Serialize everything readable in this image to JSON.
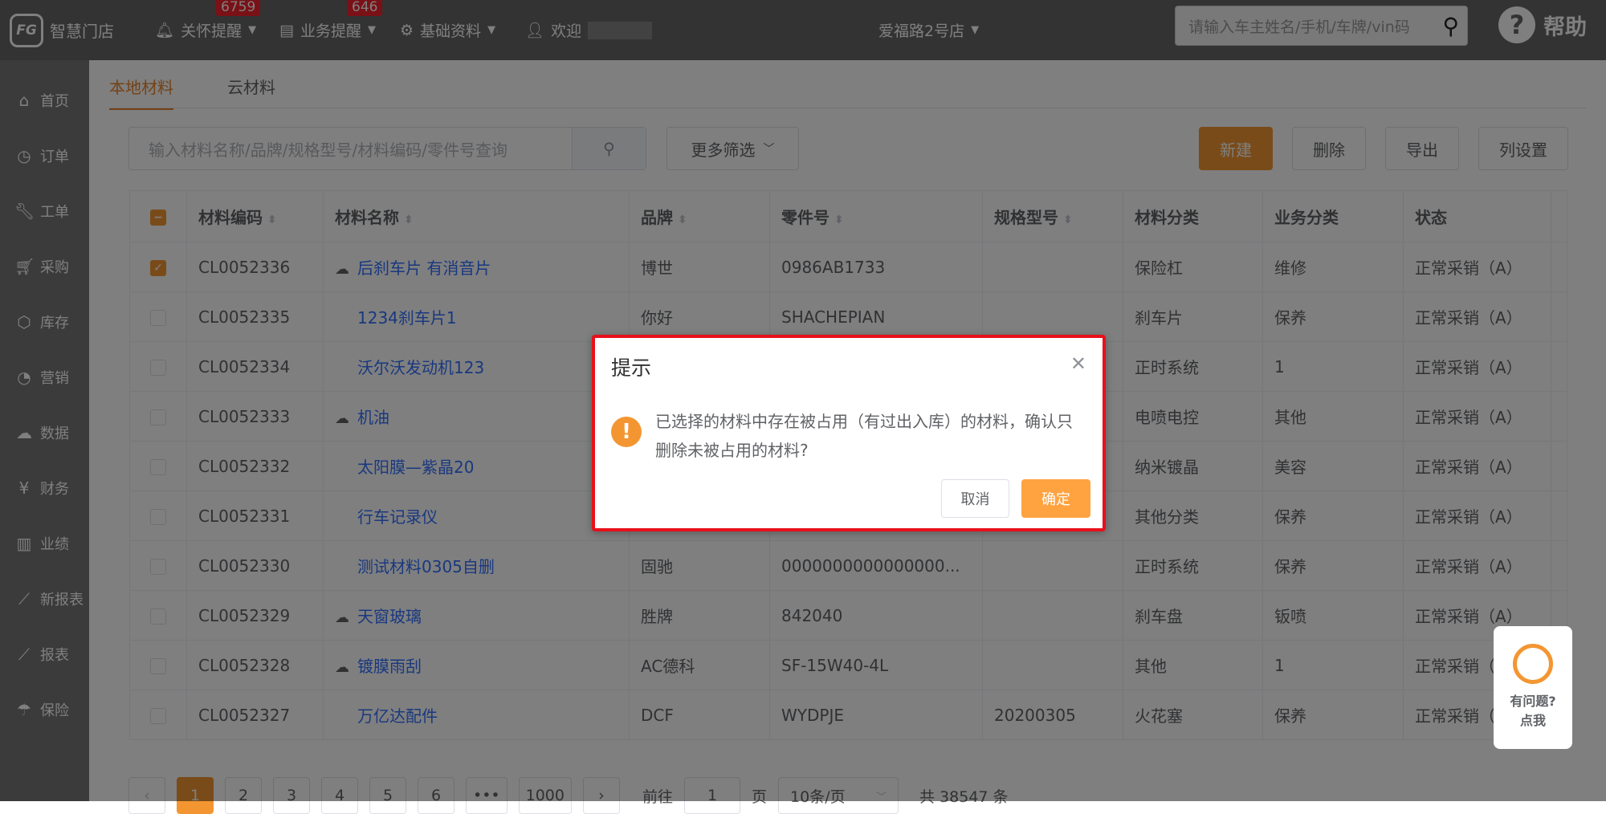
{
  "topbar": {
    "logo_text": "智慧门店",
    "care_reminder": "关怀提醒",
    "care_count": "6759",
    "business_reminder": "业务提醒",
    "business_count": "646",
    "base_data": "基础资料",
    "welcome": "欢迎",
    "store": "爱福路2号店",
    "search_placeholder": "请输入车主姓名/手机/车牌/vin码",
    "help": "帮助"
  },
  "sidebar": {
    "items": [
      {
        "label": "首页",
        "icon": "home-icon"
      },
      {
        "label": "订单",
        "icon": "clock-icon"
      },
      {
        "label": "工单",
        "icon": "wrench-icon"
      },
      {
        "label": "采购",
        "icon": "cart-icon"
      },
      {
        "label": "库存",
        "icon": "box-icon"
      },
      {
        "label": "营销",
        "icon": "pie-icon"
      },
      {
        "label": "数据",
        "icon": "cloud-icon"
      },
      {
        "label": "财务",
        "icon": "yen-icon"
      },
      {
        "label": "业绩",
        "icon": "bar-chart-icon"
      },
      {
        "label": "新报表",
        "icon": "line-chart-icon"
      },
      {
        "label": "报表",
        "icon": "line-chart-icon"
      },
      {
        "label": "保险",
        "icon": "umbrella-icon"
      }
    ]
  },
  "tabs": [
    "本地材料",
    "云材料"
  ],
  "toolbar": {
    "search_placeholder": "输入材料名称/品牌/规格型号/材料编码/零件号查询",
    "more_filters": "更多筛选",
    "new": "新建",
    "delete": "删除",
    "export": "导出",
    "column_settings": "列设置"
  },
  "table": {
    "columns": [
      "材料编码",
      "材料名称",
      "品牌",
      "零件号",
      "规格型号",
      "材料分类",
      "业务分类",
      "状态"
    ],
    "rows": [
      {
        "code": "CL0052336",
        "name": "后刹车片 有消音片",
        "brand": "博世",
        "part": "0986AB1733",
        "spec": "",
        "cat": "保险杠",
        "biz": "维修",
        "status": "正常采销（A）",
        "checked": true,
        "cloud": true
      },
      {
        "code": "CL0052335",
        "name": "1234刹车片1",
        "brand": "你好",
        "part": "SHACHEPIAN",
        "spec": "",
        "cat": "刹车片",
        "biz": "保养",
        "status": "正常采销（A）",
        "checked": false,
        "cloud": false
      },
      {
        "code": "CL0052334",
        "name": "沃尔沃发动机123",
        "brand": "",
        "part": "",
        "spec": "",
        "cat": "正时系统",
        "biz": "1",
        "status": "正常采销（A）",
        "checked": false,
        "cloud": false
      },
      {
        "code": "CL0052333",
        "name": "机油",
        "brand": "",
        "part": "",
        "spec": "",
        "cat": "电喷电控",
        "biz": "其他",
        "status": "正常采销（A）",
        "checked": false,
        "cloud": true
      },
      {
        "code": "CL0052332",
        "name": "太阳膜—紫晶20",
        "brand": "",
        "part": "",
        "spec": "",
        "cat": "纳米镀晶",
        "biz": "美容",
        "status": "正常采销（A）",
        "checked": false,
        "cloud": false
      },
      {
        "code": "CL0052331",
        "name": "行车记录仪",
        "brand": "",
        "part": "",
        "spec": "",
        "cat": "其他分类",
        "biz": "保养",
        "status": "正常采销（A）",
        "checked": false,
        "cloud": false
      },
      {
        "code": "CL0052330",
        "name": "测试材料0305自删",
        "brand": "固驰",
        "part": "0000000000000000...",
        "spec": "",
        "cat": "正时系统",
        "biz": "保养",
        "status": "正常采销（A）",
        "checked": false,
        "cloud": false
      },
      {
        "code": "CL0052329",
        "name": "天窗玻璃",
        "brand": "胜牌",
        "part": "842040",
        "spec": "",
        "cat": "刹车盘",
        "biz": "钣喷",
        "status": "正常采销（A）",
        "checked": false,
        "cloud": true
      },
      {
        "code": "CL0052328",
        "name": "镀膜雨刮",
        "brand": "AC德科",
        "part": "SF-15W40-4L",
        "spec": "",
        "cat": "其他",
        "biz": "1",
        "status": "正常采销（A）",
        "checked": false,
        "cloud": true
      },
      {
        "code": "CL0052327",
        "name": "万亿达配件",
        "brand": "DCF",
        "part": "WYDPJE",
        "spec": "20200305",
        "cat": "火花塞",
        "biz": "保养",
        "status": "正常采销（A）",
        "checked": false,
        "cloud": false
      }
    ]
  },
  "pagination": {
    "pages": [
      "1",
      "2",
      "3",
      "4",
      "5",
      "6",
      "•••",
      "1000"
    ],
    "current": "1",
    "goto_label": "前往",
    "goto_value": "1",
    "page_unit": "页",
    "page_size": "10条/页",
    "total": "共 38547 条"
  },
  "dialog": {
    "title": "提示",
    "message": "已选择的材料中存在被占用（有过出入库）的材料，确认只删除未被占用的材料?",
    "cancel": "取消",
    "confirm": "确定"
  },
  "help_float": {
    "line1": "有问题?",
    "line2": "点我"
  },
  "colors": {
    "accent": "#f39632",
    "link": "#3370ff",
    "dialog_border": "#e8101a"
  }
}
